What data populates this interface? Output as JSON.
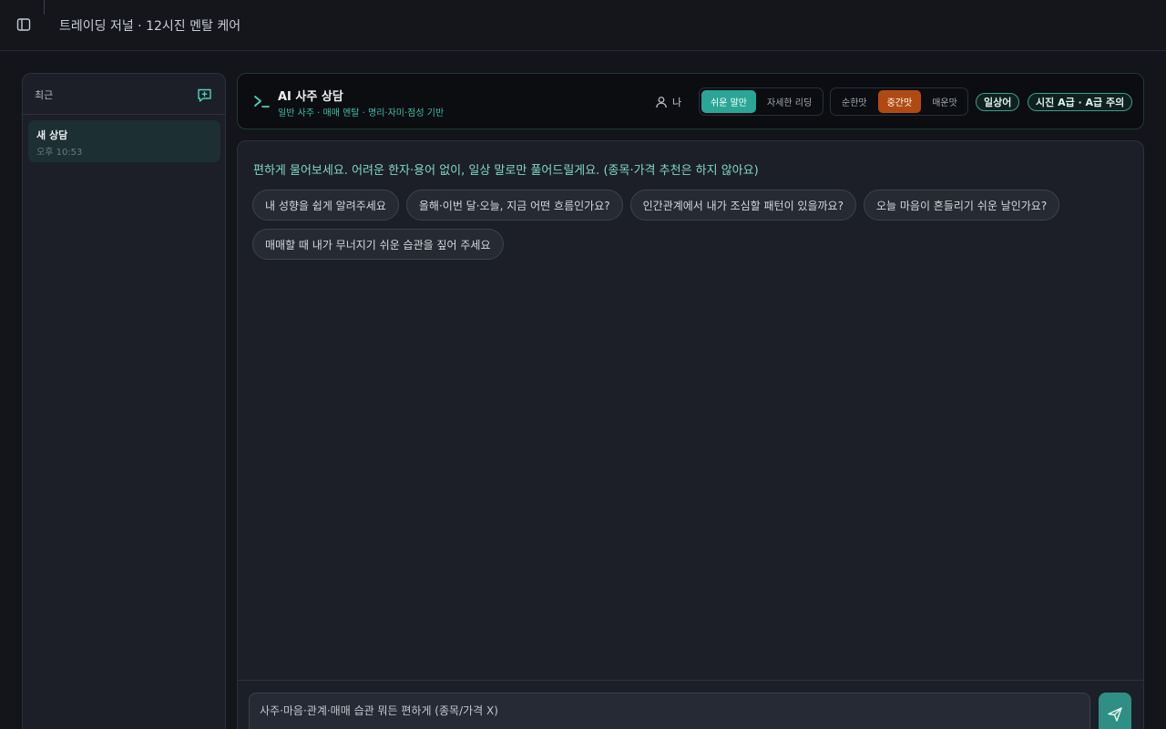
{
  "topbar": {
    "title": "트레이딩 저널 · 12시진 멘탈 케어",
    "toggle_icon": "sidebar-panel-icon"
  },
  "sidebar": {
    "header": "최근",
    "new_chat_icon": "new-chat-icon",
    "conversations": [
      {
        "title": "새 상담",
        "time": "오후 10:53"
      }
    ]
  },
  "header": {
    "icon": "terminal-prompt-icon",
    "title": "AI 사주 상담",
    "subtitle": "일반 사주 · 매매 멘탈 · 명리·자미·점성 기반",
    "profile_label": "나",
    "style_options": [
      "쉬운 말만",
      "자세한 리딩"
    ],
    "style_selected": 0,
    "tone_options": [
      "순한맛",
      "중간맛",
      "매운맛"
    ],
    "tone_selected": 1,
    "badges": [
      "일상어",
      "시진 A급 · A급 주의"
    ]
  },
  "chat": {
    "intro": "편하게 물어보세요. 어려운 한자·용어 없이, 일상 말로만 풀어드릴게요. (종목·가격 추천은 하지 않아요)",
    "suggestions": [
      "내 성향을 쉽게 알려주세요",
      "올해·이번 달·오늘, 지금 어떤 흐름인가요?",
      "인간관계에서 내가 조심할 패턴이 있을까요?",
      "오늘 마음이 흔들리기 쉬운 날인가요?",
      "매매할 때 내가 무너지기 쉬운 습관을 짚어 주세요"
    ],
    "input_placeholder": "사주·마음·관계·매매 습관 뭐든 편하게 (종목/가격 X)",
    "send_icon": "send-icon"
  },
  "colors": {
    "accent": "#2aa596",
    "tone_active": "#b04a12",
    "subtitle": "#3fbfa9",
    "intro_text": "#7fd8c8"
  }
}
